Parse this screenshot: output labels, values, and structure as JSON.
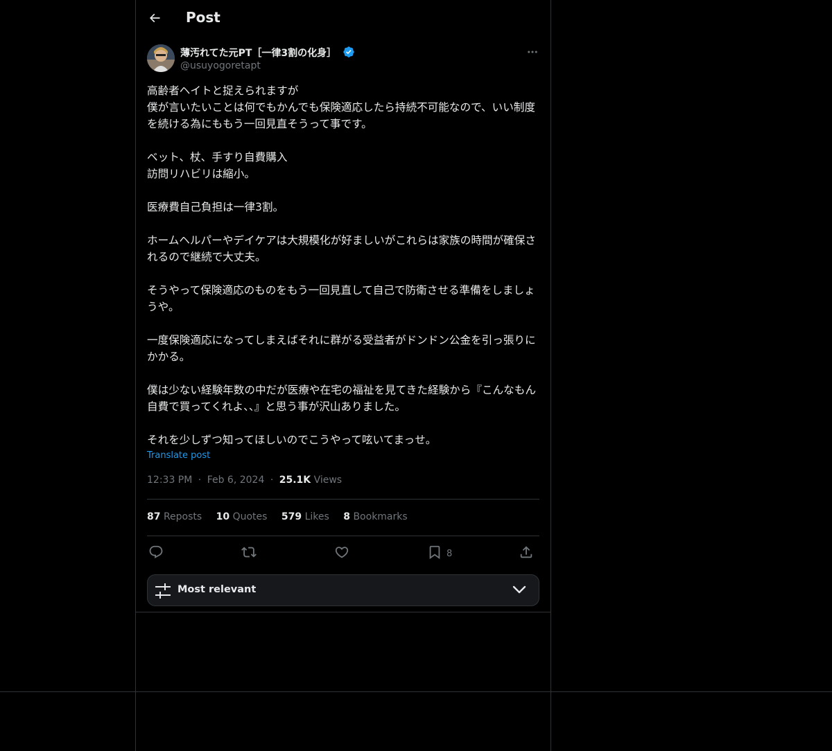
{
  "header": {
    "title": "Post"
  },
  "post": {
    "author_name": "薄汚れてた元PT［一律3割の化身］",
    "handle": "@usuyogoretapt",
    "paragraphs": [
      [
        "高齢者ヘイトと捉えられますが",
        "僕が言いたいことは何でもかんでも保険適応したら持続不可能なので、いい制度を続ける為にももう一回見直そうって事です。"
      ],
      [
        "ベット、杖、手すり自費購入",
        "訪問リハビリは縮小。"
      ],
      [
        "医療費自己負担は一律3割。"
      ],
      [
        "ホームヘルパーやデイケアは大規模化が好ましいがこれらは家族の時間が確保されるので継続で大丈夫。"
      ],
      [
        "そうやって保険適応のものをもう一回見直して自己で防衛させる準備をしましょうや。"
      ],
      [
        "一度保険適応になってしまえばそれに群がる受益者がドンドン公金を引っ張りにかかる。"
      ],
      [
        "僕は少ない経験年数の中だが医療や在宅の福祉を見てきた経験から『こんなもん自費で買ってくれよ、、』と思う事が沢山ありました。"
      ],
      [
        "それを少しずつ知ってほしいのでこうやって呟いてまっせ。"
      ]
    ],
    "translate_label": "Translate post",
    "time": "12:33 PM",
    "dot1": "·",
    "date": "Feb 6, 2024",
    "dot2": "·",
    "views_count": "25.1K",
    "views_label": "Views"
  },
  "stats": {
    "reposts_count": "87",
    "reposts_label": "Reposts",
    "quotes_count": "10",
    "quotes_label": "Quotes",
    "likes_count": "579",
    "likes_label": "Likes",
    "bookmarks_count": "8",
    "bookmarks_label": "Bookmarks"
  },
  "actions": {
    "bookmark_count": "8"
  },
  "sort": {
    "label": "Most relevant"
  },
  "colors": {
    "background": "#000000",
    "border": "#2f3336",
    "text": "#e7e9ea",
    "muted": "#71767b",
    "link": "#1d9bf0",
    "verified": "#1d9bf0"
  }
}
